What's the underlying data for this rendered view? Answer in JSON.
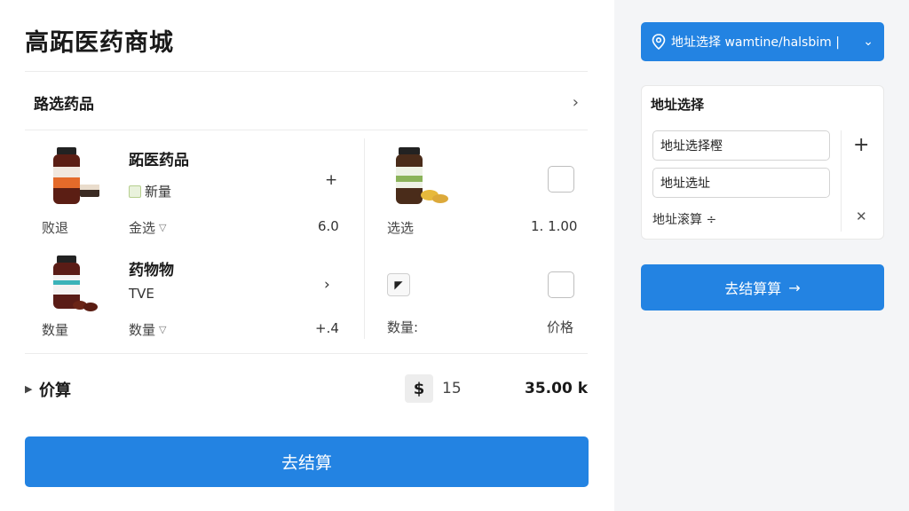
{
  "app": {
    "title": "高跖医药商城"
  },
  "section": {
    "title": "路选药品"
  },
  "products": [
    {
      "name": "跖医药品",
      "sub": "新量",
      "label": "败退",
      "select": "金选",
      "control": "+",
      "value": "6.0"
    },
    {
      "sub": "",
      "label": "选选",
      "value": "1. 1.00"
    },
    {
      "name": "药物物",
      "sub": "TVE",
      "label": "数量",
      "select": "数量",
      "control": "›",
      "value": "+.4"
    },
    {
      "label": "数量:",
      "value": "价格"
    }
  ],
  "total": {
    "label": "价算",
    "currency": "$",
    "quantity": "15",
    "amount": "35.00 k"
  },
  "checkout": {
    "label": "去结算",
    "side_label": "去结算算"
  },
  "address_button": {
    "label": "地址选择 wamtine/halsbim |"
  },
  "address_card": {
    "title": "地址选择",
    "input1": "地址选择樫",
    "input2": "地址选址",
    "note": "地址滚算 ÷"
  },
  "colors": {
    "accent": "#2383e2"
  },
  "icons": [
    "chevron-right-icon",
    "plus-icon",
    "close-icon",
    "location-pin-icon",
    "chevron-down-icon",
    "arrow-right-icon",
    "triangle-right-icon",
    "dollar-icon"
  ]
}
